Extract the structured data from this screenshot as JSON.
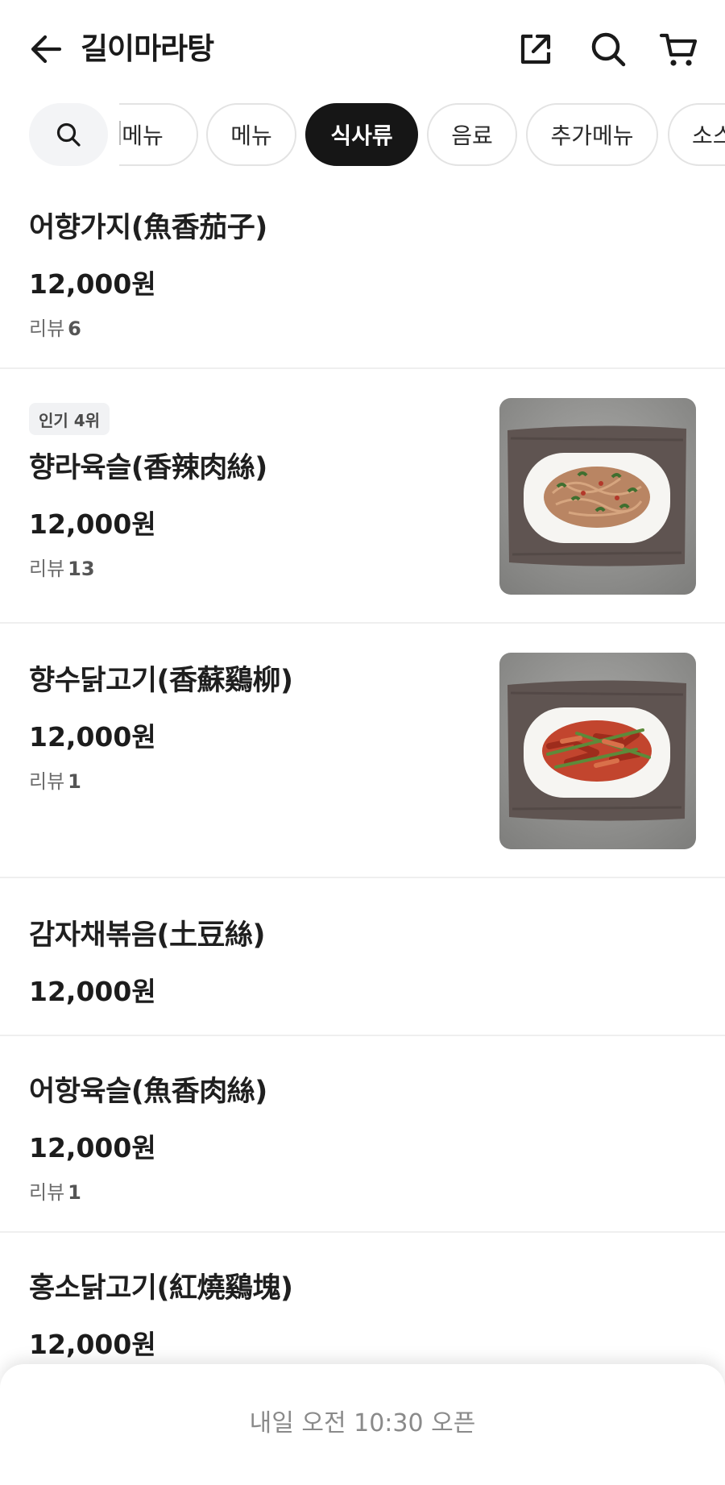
{
  "header": {
    "title": "길이마라탕"
  },
  "icons": {
    "back": "arrow-left-icon",
    "share": "share-external-icon",
    "search": "search-icon",
    "cart": "cart-icon"
  },
  "categories": {
    "search_chip_icon": "search-icon",
    "tabs": [
      {
        "label": "메뉴",
        "active": false
      },
      {
        "label": "메뉴",
        "active": false
      },
      {
        "label": "식사류",
        "active": true
      },
      {
        "label": "음료",
        "active": false
      },
      {
        "label": "추가메뉴",
        "active": false
      },
      {
        "label": "소스",
        "active": false
      }
    ]
  },
  "menu": {
    "review_label": "리뷰",
    "items": [
      {
        "name": "어향가지(魚香茄子)",
        "price": "12,000원",
        "reviews": "6"
      },
      {
        "badge": "인기 4위",
        "name": "향라육슬(香辣肉絲)",
        "price": "12,000원",
        "reviews": "13"
      },
      {
        "name": "향수닭고기(香蘇鷄柳)",
        "price": "12,000원",
        "reviews": "1"
      },
      {
        "name": "감자채볶음(土豆絲)",
        "price": "12,000원"
      },
      {
        "name": "어항육슬(魚香肉絲)",
        "price": "12,000원",
        "reviews": "1"
      },
      {
        "name": "홍소닭고기(紅燒鷄塊)",
        "price": "12,000원"
      }
    ]
  },
  "footer": {
    "status": "내일 오전 10:30 오픈"
  },
  "colors": {
    "active_chip": "#161616",
    "divider": "#efefef",
    "chip_border": "#e3e3e3"
  }
}
